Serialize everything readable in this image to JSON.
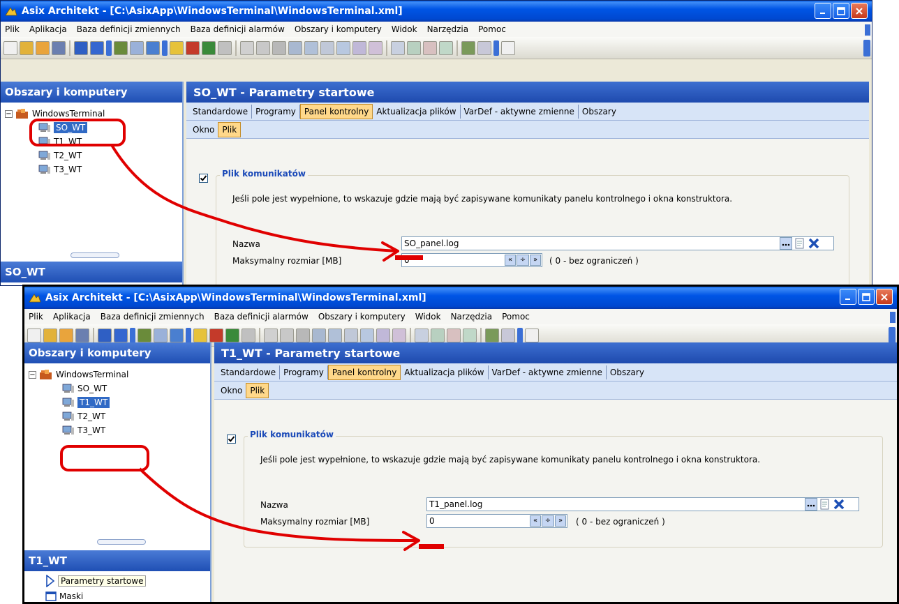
{
  "windows": [
    {
      "title": "Asix Architekt - [C:\\AsixApp\\WindowsTerminal\\WindowsTerminal.xml]",
      "menu": [
        "Plik",
        "Aplikacja",
        "Baza definicji zmiennych",
        "Baza definicji alarmów",
        "Obszary i komputery",
        "Widok",
        "Narzędzia",
        "Pomoc"
      ],
      "left_header": "Obszary i komputery",
      "tree_root": "WindowsTerminal",
      "tree_children": [
        "SO_WT",
        "T1_WT",
        "T2_WT",
        "T3_WT"
      ],
      "selected_child": "SO_WT",
      "bottom_header": "SO_WT",
      "panel_title": "SO_WT - Parametry startowe",
      "tabs": [
        "Standardowe",
        "Programy",
        "Panel kontrolny",
        "Aktualizacja plików",
        "VarDef - aktywne zmienne",
        "Obszary"
      ],
      "active_tab": "Panel kontrolny",
      "subtabs": [
        "Okno",
        "Plik"
      ],
      "active_subtab": "Plik",
      "group_title": "Plik komunikatów",
      "checkbox_checked": true,
      "description": "Jeśli pole jest wypełnione, to wskazuje gdzie mają być zapisywane komunikaty panelu kontrolnego i okna konstruktora.",
      "name_label": "Nazwa",
      "name_value": "SO_panel.log",
      "size_label": "Maksymalny rozmiar [MB]",
      "size_value": "0",
      "size_hint": "( 0 - bez ograniczeń )"
    },
    {
      "title": "Asix Architekt - [C:\\AsixApp\\WindowsTerminal\\WindowsTerminal.xml]",
      "menu": [
        "Plik",
        "Aplikacja",
        "Baza definicji zmiennych",
        "Baza definicji alarmów",
        "Obszary i komputery",
        "Widok",
        "Narzędzia",
        "Pomoc"
      ],
      "left_header": "Obszary i komputery",
      "tree_root": "WindowsTerminal",
      "tree_children": [
        "SO_WT",
        "T1_WT",
        "T2_WT",
        "T3_WT"
      ],
      "selected_child": "T1_WT",
      "bottom_header": "T1_WT",
      "bottom_items": [
        "Parametry startowe",
        "Maski"
      ],
      "panel_title": "T1_WT - Parametry startowe",
      "tabs": [
        "Standardowe",
        "Programy",
        "Panel kontrolny",
        "Aktualizacja plików",
        "VarDef - aktywne zmienne",
        "Obszary"
      ],
      "active_tab": "Panel kontrolny",
      "subtabs": [
        "Okno",
        "Plik"
      ],
      "active_subtab": "Plik",
      "group_title": "Plik komunikatów",
      "checkbox_checked": true,
      "description": "Jeśli pole jest wypełnione, to wskazuje gdzie mają być zapisywane komunikaty panelu kontrolnego i okna konstruktora.",
      "name_label": "Nazwa",
      "name_value": "T1_panel.log",
      "size_label": "Maksymalny rozmiar [MB]",
      "size_value": "0",
      "size_hint": "( 0 - bez ograniczeń )"
    }
  ],
  "colors": {
    "titlebar": "#0055e5",
    "selection": "#316ac5",
    "active_tab": "#ffd88a",
    "annotation": "#e00000",
    "group_title": "#1a49b8"
  },
  "icons": [
    "app-icon",
    "minimize-icon",
    "maximize-icon",
    "close-icon",
    "folder-icon",
    "computer-icon",
    "browse-icon",
    "clear-icon"
  ]
}
